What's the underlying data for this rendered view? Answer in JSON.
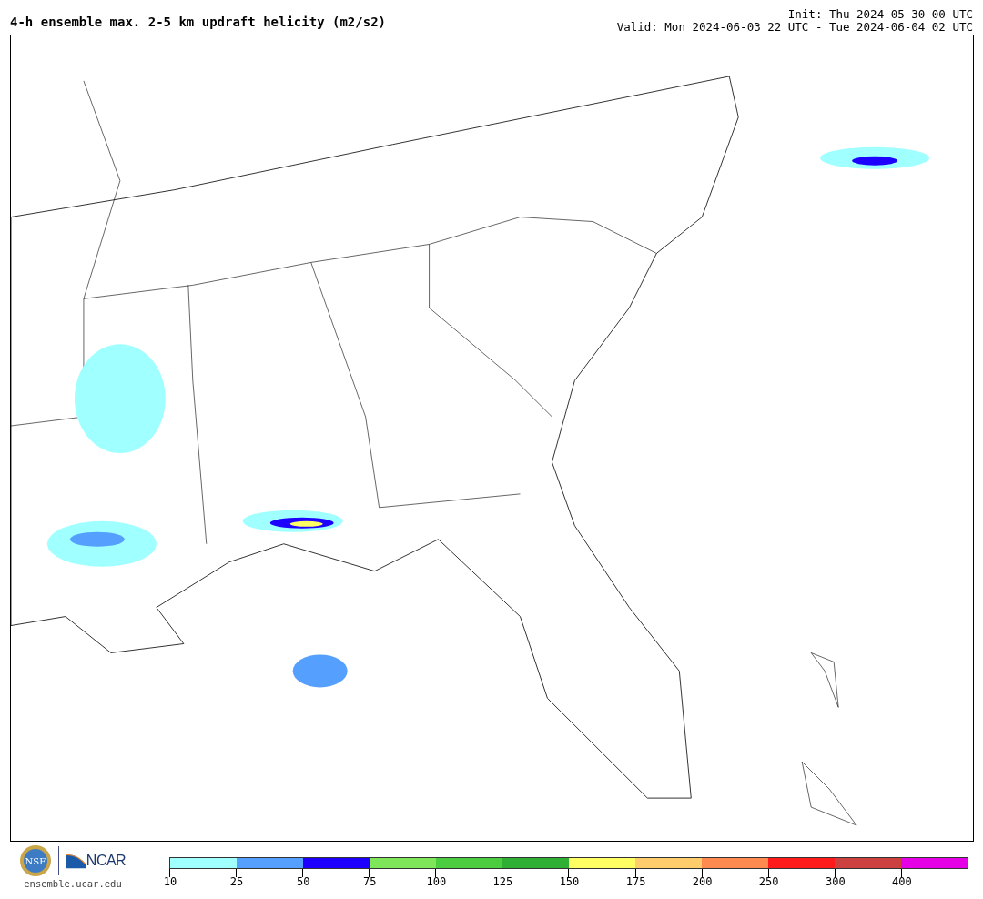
{
  "title": "4-h ensemble max. 2-5 km updraft helicity (m2/s2)",
  "init": "Init: Thu 2024-05-30 00 UTC",
  "valid": "Valid: Mon 2024-06-03 22 UTC - Tue 2024-06-04 02 UTC",
  "logos": {
    "nsf": "NSF",
    "ncar": "NCAR",
    "url": "ensemble.ucar.edu"
  },
  "colorbar": {
    "bins": [
      {
        "color": "#a0ffff",
        "label": "10"
      },
      {
        "color": "#55a0ff",
        "label": "25"
      },
      {
        "color": "#1e00ff",
        "label": "50"
      },
      {
        "color": "#7fe65a",
        "label": "75"
      },
      {
        "color": "#4ccd40",
        "label": "100"
      },
      {
        "color": "#2fb034",
        "label": "125"
      },
      {
        "color": "#ffff64",
        "label": "150"
      },
      {
        "color": "#ffcd6b",
        "label": "175"
      },
      {
        "color": "#ff8a4f",
        "label": "200"
      },
      {
        "color": "#ff1b1b",
        "label": "250"
      },
      {
        "color": "#cc4040",
        "label": "300"
      },
      {
        "color": "#e600e6",
        "label": "400"
      }
    ]
  }
}
